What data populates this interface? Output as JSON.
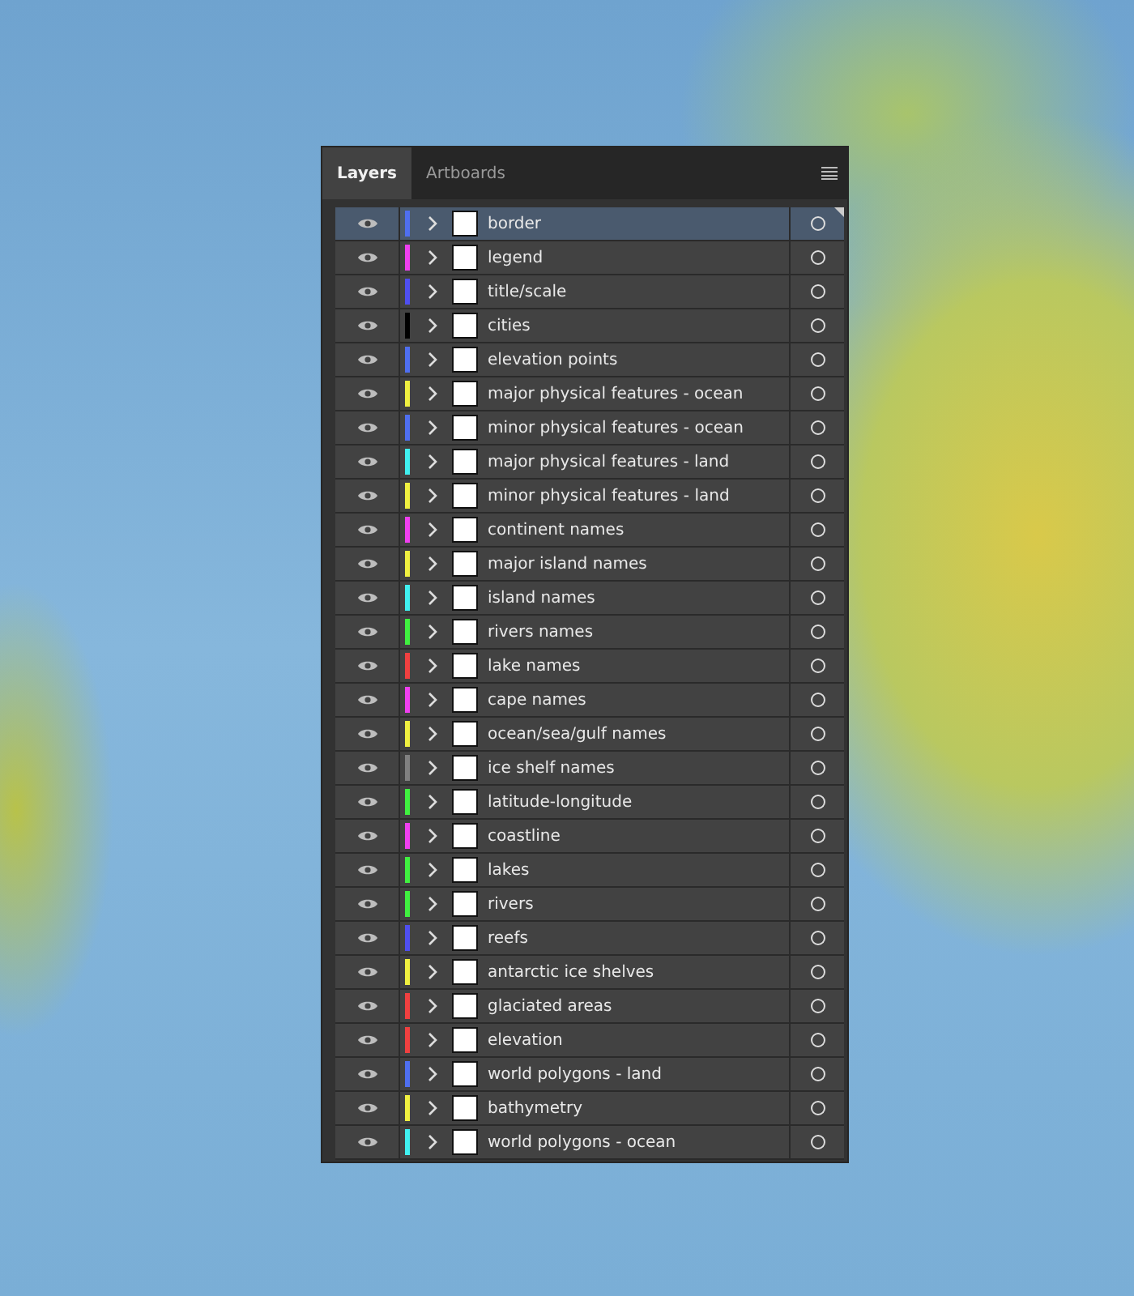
{
  "panel": {
    "tabs": [
      {
        "label": "Layers",
        "selected": true
      },
      {
        "label": "Artboards",
        "selected": false
      }
    ],
    "layers": [
      {
        "name": "border",
        "color": "#4f6ff0",
        "selected": true
      },
      {
        "name": "legend",
        "color": "#f040f0",
        "selected": false
      },
      {
        "name": "title/scale",
        "color": "#4f4ff0",
        "selected": false
      },
      {
        "name": "cities",
        "color": "#000000",
        "selected": false
      },
      {
        "name": "elevation points",
        "color": "#4f6ff0",
        "selected": false
      },
      {
        "name": "major physical features - ocean",
        "color": "#f0f040",
        "selected": false
      },
      {
        "name": "minor physical features - ocean",
        "color": "#4f6ff0",
        "selected": false
      },
      {
        "name": "major physical features - land",
        "color": "#40f0f0",
        "selected": false
      },
      {
        "name": "minor physical features - land",
        "color": "#f0f040",
        "selected": false
      },
      {
        "name": "continent names",
        "color": "#f040f0",
        "selected": false
      },
      {
        "name": "major island names",
        "color": "#f0f040",
        "selected": false
      },
      {
        "name": "island names",
        "color": "#40f0f0",
        "selected": false
      },
      {
        "name": "rivers names",
        "color": "#40f040",
        "selected": false
      },
      {
        "name": "lake names",
        "color": "#f04040",
        "selected": false
      },
      {
        "name": "cape names",
        "color": "#f040f0",
        "selected": false
      },
      {
        "name": "ocean/sea/gulf names",
        "color": "#f0f040",
        "selected": false
      },
      {
        "name": "ice shelf names",
        "color": "#808080",
        "selected": false
      },
      {
        "name": "latitude-longitude",
        "color": "#40f040",
        "selected": false
      },
      {
        "name": "coastline",
        "color": "#f040f0",
        "selected": false
      },
      {
        "name": "lakes",
        "color": "#40f040",
        "selected": false
      },
      {
        "name": "rivers",
        "color": "#40f040",
        "selected": false
      },
      {
        "name": "reefs",
        "color": "#4f4ff0",
        "selected": false
      },
      {
        "name": "antarctic ice shelves",
        "color": "#f0f040",
        "selected": false
      },
      {
        "name": "glaciated areas",
        "color": "#f04040",
        "selected": false
      },
      {
        "name": "elevation",
        "color": "#f04040",
        "selected": false
      },
      {
        "name": "world polygons - land",
        "color": "#4f6ff0",
        "selected": false
      },
      {
        "name": "bathymetry",
        "color": "#f0f040",
        "selected": false
      },
      {
        "name": "world polygons - ocean",
        "color": "#40f0f0",
        "selected": false
      }
    ]
  }
}
